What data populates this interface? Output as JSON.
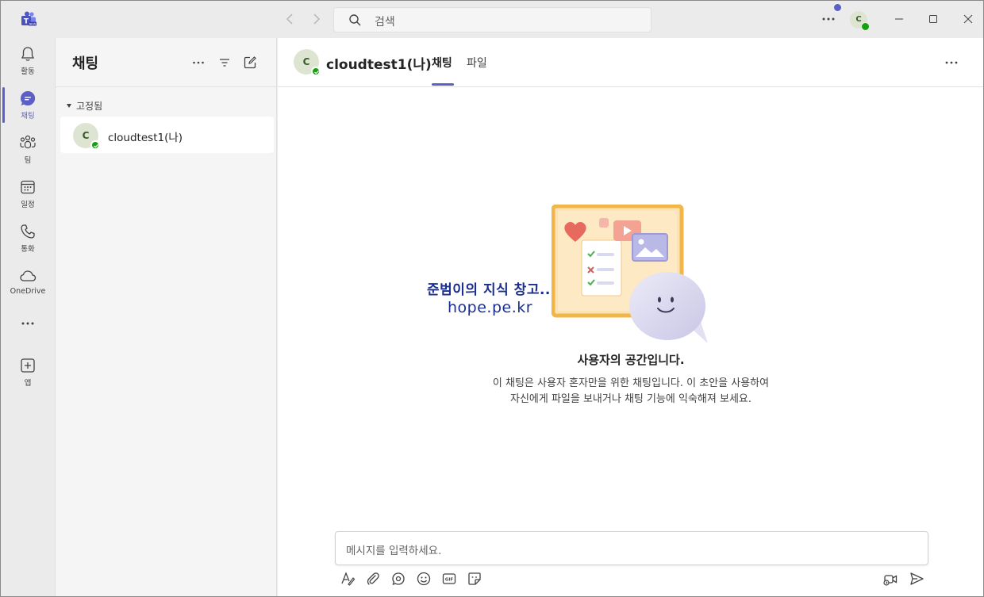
{
  "titlebar": {
    "search_placeholder": "검색",
    "avatar_initial": "C"
  },
  "rail": {
    "items": [
      {
        "label": "활동",
        "icon": "bell-icon"
      },
      {
        "label": "채팅",
        "icon": "chat-icon",
        "active": true
      },
      {
        "label": "팀",
        "icon": "teams-icon"
      },
      {
        "label": "일정",
        "icon": "calendar-icon"
      },
      {
        "label": "통화",
        "icon": "phone-icon"
      },
      {
        "label": "OneDrive",
        "icon": "cloud-icon"
      },
      {
        "label": "앱",
        "icon": "add-app-icon"
      }
    ]
  },
  "chat_list": {
    "title": "채팅",
    "pinned_label": "고정됨",
    "chats": [
      {
        "initial": "C",
        "name": "cloudtest1(나)"
      }
    ]
  },
  "main": {
    "header": {
      "initial": "C",
      "name": "cloudtest1(나)",
      "tabs": [
        {
          "label": "채팅",
          "active": true
        },
        {
          "label": "파일",
          "active": false
        }
      ]
    },
    "watermark": {
      "line1": "준범이의 지식 창고..",
      "line2": "hope.pe.kr"
    },
    "empty_state": {
      "title": "사용자의 공간입니다.",
      "line1": "이 채팅은 사용자 혼자만을 위한 채팅입니다. 이 초안을 사용하여",
      "line2": "자신에게 파일을 보내거나 채팅 기능에 익숙해져 보세요."
    },
    "composer": {
      "placeholder": "메시지를 입력하세요."
    }
  },
  "colors": {
    "accent": "#5b5fc7",
    "presence_available": "#13a10e",
    "avatar_bg": "#dde5d2"
  }
}
